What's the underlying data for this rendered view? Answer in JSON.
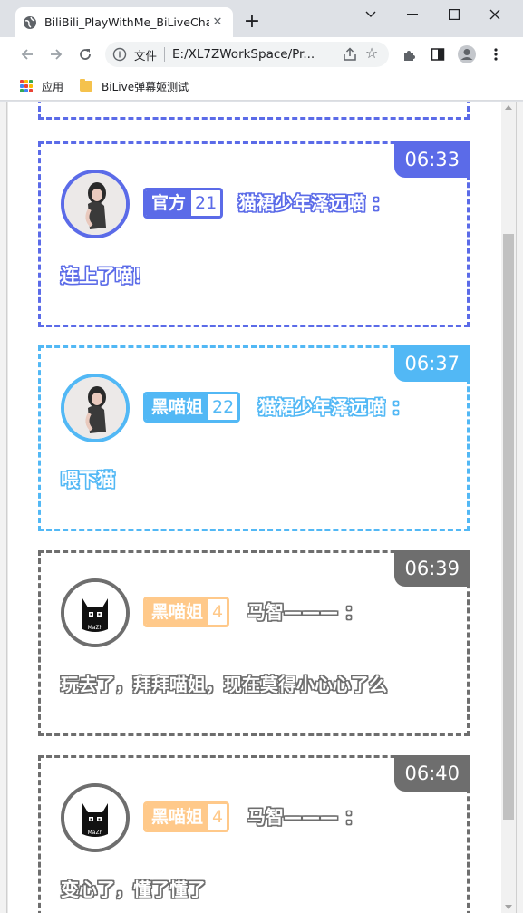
{
  "browser": {
    "tab_title": "BiliBili_PlayWithMe_BiLiveChat",
    "omnibox_label": "文件",
    "url": "E:/XL7ZWorkSpace/Pr...",
    "bookmarks": [
      {
        "label": "应用",
        "icon": "apps-grid-icon"
      },
      {
        "label": "BiLive弹幕姬测试",
        "icon": "folder-icon"
      }
    ]
  },
  "colors": {
    "officer": "#5b6be8",
    "member": "#52b8f5",
    "guest": "#6e6e6e",
    "guest_badge": "#ffc98a"
  },
  "messages": [
    {
      "time": "06:33",
      "badge_name": "官方",
      "badge_level": "21",
      "username": "猫裙少年泽远喵 ：",
      "text": "连上了喵！",
      "theme": "officer"
    },
    {
      "time": "06:37",
      "badge_name": "黑喵姐",
      "badge_level": "22",
      "username": "猫裙少年泽远喵 ：",
      "text": "喂下猫",
      "theme": "member"
    },
    {
      "time": "06:39",
      "badge_name": "黑喵姐",
      "badge_level": "4",
      "username": "马智——— ：",
      "text": "玩去了，拜拜喵姐，现在莫得小心心了么",
      "theme": "guest"
    },
    {
      "time": "06:40",
      "badge_name": "黑喵姐",
      "badge_level": "4",
      "username": "马智——— ：",
      "text": "变心了，懂了懂了",
      "theme": "guest"
    }
  ]
}
